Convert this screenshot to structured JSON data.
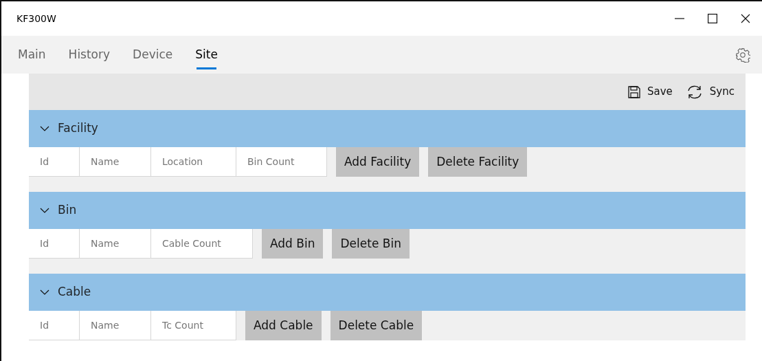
{
  "window": {
    "title": "KF300W"
  },
  "tabs": [
    {
      "label": "Main",
      "selected": false
    },
    {
      "label": "History",
      "selected": false
    },
    {
      "label": "Device",
      "selected": false
    },
    {
      "label": "Site",
      "selected": true
    }
  ],
  "toolbar": [
    {
      "kind": "save",
      "label": "Save"
    },
    {
      "kind": "sync",
      "label": "Sync"
    }
  ],
  "sections": [
    {
      "title": "Facility",
      "expanded": true,
      "fields": [
        {
          "placeholder": "Id"
        },
        {
          "placeholder": "Name"
        },
        {
          "placeholder": "Location"
        },
        {
          "placeholder": "Bin Count"
        }
      ],
      "buttons": [
        "Add Facility",
        "Delete Facility"
      ]
    },
    {
      "title": "Bin",
      "expanded": true,
      "fields": [
        {
          "placeholder": "Id"
        },
        {
          "placeholder": "Name"
        },
        {
          "placeholder": "Cable Count"
        }
      ],
      "buttons": [
        "Add Bin",
        "Delete Bin"
      ]
    },
    {
      "title": "Cable",
      "expanded": true,
      "fields": [
        {
          "placeholder": "Id"
        },
        {
          "placeholder": "Name"
        },
        {
          "placeholder": "Tc Count"
        }
      ],
      "buttons": [
        "Add Cable",
        "Delete Cable"
      ]
    }
  ]
}
